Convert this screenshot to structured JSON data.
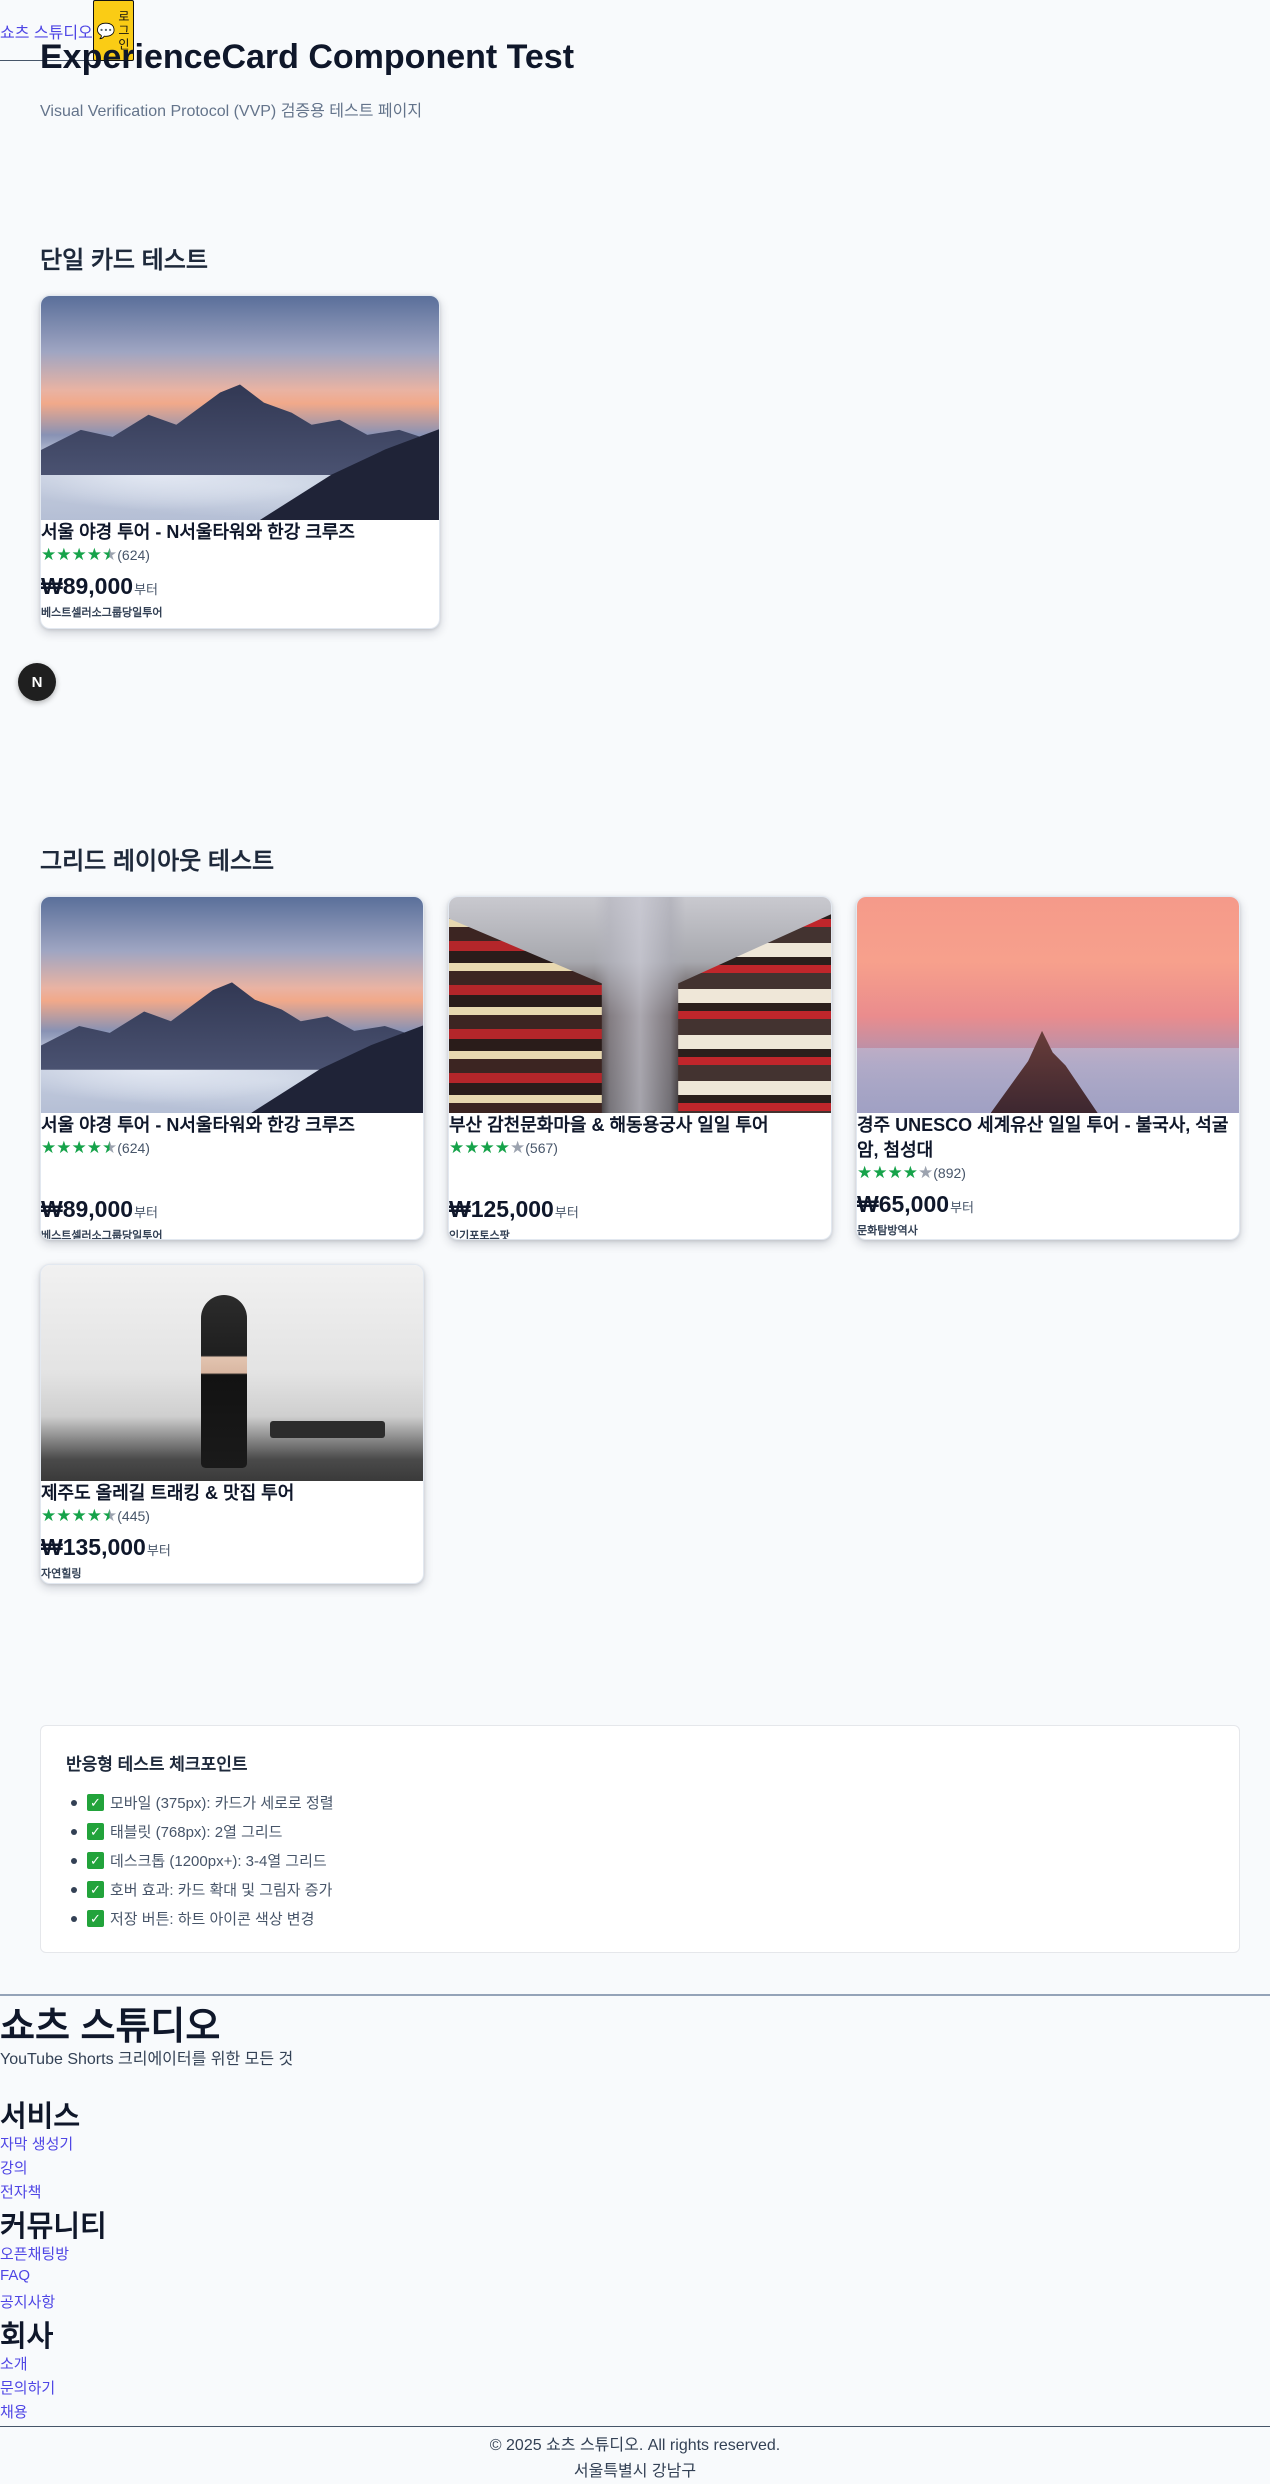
{
  "header": {
    "logo": "쇼츠 스튜디오",
    "login_label": "로그인"
  },
  "page": {
    "title": "ExperienceCard Component Test",
    "subtitle": "Visual Verification Protocol (VVP) 검증용 테스트 페이지"
  },
  "sections": {
    "single_title": "단일 카드 테스트",
    "grid_title": "그리드 레이아웃 테스트"
  },
  "single_card": {
    "title": "서울 야경 투어 - N서울타워와 한강 크루즈",
    "rating": 4.5,
    "review_count": "(624)",
    "price": "₩89,000",
    "price_suffix": "부터",
    "tags": "베스트셀러소그룹당일투어"
  },
  "grid_cards": [
    {
      "title": "서울 야경 투어 - N서울타워와 한강 크루즈",
      "rating": 4.5,
      "review_count": "(624)",
      "price": "₩89,000",
      "price_suffix": "부터",
      "tags": "베스트셀러소그룹당일투어"
    },
    {
      "title": "부산 감천문화마을 & 해동용궁사 일일 투어",
      "rating": 4,
      "review_count": "(567)",
      "price": "₩125,000",
      "price_suffix": "부터",
      "tags": "인기포토스팟"
    },
    {
      "title": "경주 UNESCO 세계유산 일일 투어 - 불국사, 석굴암, 첨성대",
      "rating": 4,
      "review_count": "(892)",
      "price": "₩65,000",
      "price_suffix": "부터",
      "tags": "문화탐방역사"
    },
    {
      "title": "제주도 올레길 트래킹 & 맛집 투어",
      "rating": 4.5,
      "review_count": "(445)",
      "price": "₩135,000",
      "price_suffix": "부터",
      "tags": "자연힐링"
    }
  ],
  "n_badge": "N",
  "checklist": {
    "title": "반응형 테스트 체크포인트",
    "check_mark": "✓",
    "items": [
      "모바일 (375px): 카드가 세로로 정렬",
      "태블릿 (768px): 2열 그리드",
      "데스크톱 (1200px+): 3-4열 그리드",
      "호버 효과: 카드 확대 및 그림자 증가",
      "저장 버튼: 하트 아이콘 색상 변경"
    ]
  },
  "footer": {
    "brand": "쇼츠 스튜디오",
    "tagline": "YouTube Shorts 크리에이터를 위한 모든 것",
    "groups": [
      {
        "heading": "서비스",
        "links": [
          "자막 생성기",
          "강의",
          "전자책"
        ]
      },
      {
        "heading": "커뮤니티",
        "links": [
          "오픈채팅방",
          "FAQ",
          "공지사항"
        ]
      },
      {
        "heading": "회사",
        "links": [
          "소개",
          "문의하기",
          "채용"
        ]
      }
    ],
    "copyright": "© 2025 쇼츠 스튜디오. All rights reserved.",
    "address": "서울특별시 강남구"
  },
  "colors": {
    "star_on": "#16a34a",
    "star_off": "#9ca3af",
    "link": "#4f46e5",
    "login_bg": "#facc15"
  }
}
